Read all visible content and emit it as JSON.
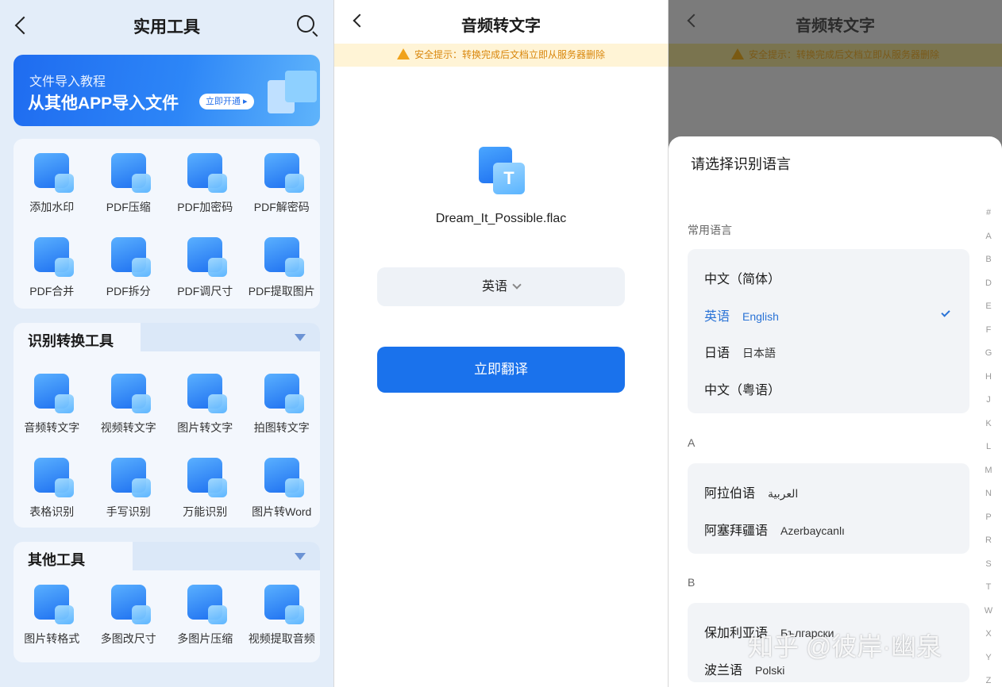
{
  "panel1": {
    "title": "实用工具",
    "banner": {
      "subtitle": "文件导入教程",
      "headline": "从其他APP导入文件",
      "button": "立即开通"
    },
    "pdf_tools": [
      "添加水印",
      "PDF压缩",
      "PDF加密码",
      "PDF解密码",
      "PDF合并",
      "PDF拆分",
      "PDF调尺寸",
      "PDF提取图片"
    ],
    "recognition": {
      "title": "识别转换工具",
      "items": [
        "音频转文字",
        "视频转文字",
        "图片转文字",
        "拍图转文字",
        "表格识别",
        "手写识别",
        "万能识别",
        "图片转Word"
      ]
    },
    "other": {
      "title": "其他工具",
      "items": [
        "图片转格式",
        "多图改尺寸",
        "多图片压缩",
        "视频提取音频"
      ]
    }
  },
  "panel2": {
    "title": "音频转文字",
    "warning": "安全提示：转换完成后文档立即从服务器删除",
    "file_icon_letter": "T",
    "file_name": "Dream_It_Possible.flac",
    "language": "英语",
    "action_button": "立即翻译"
  },
  "panel3": {
    "title": "音频转文字",
    "warning": "安全提示：转换完成后文档立即从服务器删除",
    "sheet_title": "请选择识别语言",
    "common_label": "常用语言",
    "common": [
      {
        "name": "中文（简体）",
        "native": ""
      },
      {
        "name": "英语",
        "native": "English",
        "selected": true
      },
      {
        "name": "日语",
        "native": "日本語"
      },
      {
        "name": "中文（粤语）",
        "native": ""
      }
    ],
    "group_a": {
      "label": "A",
      "items": [
        {
          "name": "阿拉伯语",
          "native": "العربية"
        },
        {
          "name": "阿塞拜疆语",
          "native": "Azerbaycanlı"
        }
      ]
    },
    "group_b": {
      "label": "B",
      "items": [
        {
          "name": "保加利亚语",
          "native": "Български"
        },
        {
          "name": "波兰语",
          "native": "Polski"
        }
      ]
    },
    "index": [
      "#",
      "A",
      "B",
      "D",
      "E",
      "F",
      "G",
      "H",
      "J",
      "K",
      "L",
      "M",
      "N",
      "P",
      "R",
      "S",
      "T",
      "W",
      "X",
      "Y",
      "Z"
    ]
  },
  "watermark": "知乎 @彼岸·幽泉"
}
